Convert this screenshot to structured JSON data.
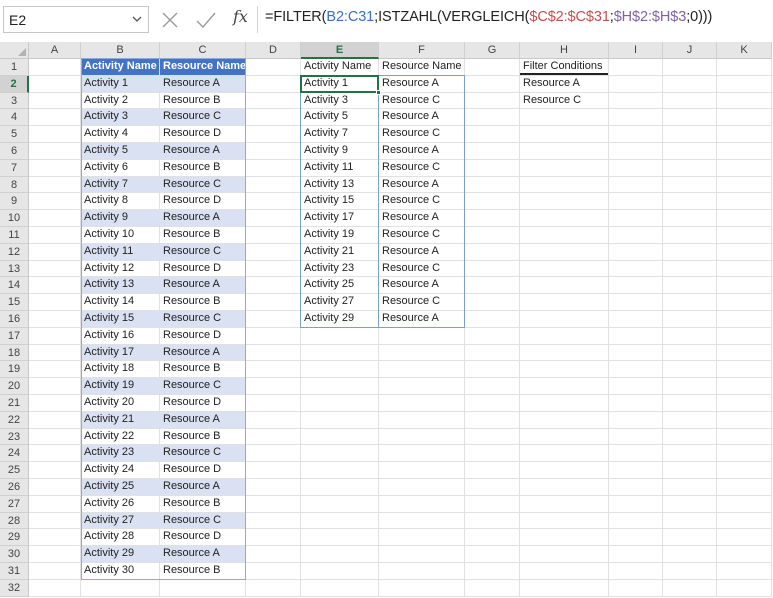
{
  "name_box": {
    "value": "E2"
  },
  "formula_bar": {
    "segments": [
      {
        "text": "=FILTER(",
        "color": "#222222"
      },
      {
        "text": "B2:C31",
        "color": "#3a6fc4"
      },
      {
        "text": ";ISTZAHL(VERGLEICH(",
        "color": "#222222"
      },
      {
        "text": "$C$2:$C$31",
        "color": "#c0504d"
      },
      {
        "text": ";",
        "color": "#222222"
      },
      {
        "text": "$H$2:$H$3",
        "color": "#8064a2"
      },
      {
        "text": ";0)))",
        "color": "#222222"
      }
    ]
  },
  "columns": [
    "A",
    "B",
    "C",
    "D",
    "E",
    "F",
    "G",
    "H",
    "I",
    "J",
    "K"
  ],
  "rows": [
    "1",
    "2",
    "3",
    "4",
    "5",
    "6",
    "7",
    "8",
    "9",
    "10",
    "11",
    "12",
    "13",
    "14",
    "15",
    "16",
    "17",
    "18",
    "19",
    "20",
    "21",
    "22",
    "23",
    "24",
    "25",
    "26",
    "27",
    "28",
    "29",
    "30",
    "31",
    "32"
  ],
  "selected": {
    "column": "E",
    "row": "2"
  },
  "source_table": {
    "headers": [
      "Activity Name",
      "Resource Name"
    ],
    "rows": [
      [
        "Activity 1",
        "Resource A"
      ],
      [
        "Activity 2",
        "Resource B"
      ],
      [
        "Activity 3",
        "Resource C"
      ],
      [
        "Activity 4",
        "Resource D"
      ],
      [
        "Activity 5",
        "Resource A"
      ],
      [
        "Activity 6",
        "Resource B"
      ],
      [
        "Activity 7",
        "Resource C"
      ],
      [
        "Activity 8",
        "Resource D"
      ],
      [
        "Activity 9",
        "Resource A"
      ],
      [
        "Activity 10",
        "Resource B"
      ],
      [
        "Activity 11",
        "Resource C"
      ],
      [
        "Activity 12",
        "Resource D"
      ],
      [
        "Activity 13",
        "Resource A"
      ],
      [
        "Activity 14",
        "Resource B"
      ],
      [
        "Activity 15",
        "Resource C"
      ],
      [
        "Activity 16",
        "Resource D"
      ],
      [
        "Activity 17",
        "Resource A"
      ],
      [
        "Activity 18",
        "Resource B"
      ],
      [
        "Activity 19",
        "Resource C"
      ],
      [
        "Activity 20",
        "Resource D"
      ],
      [
        "Activity 21",
        "Resource A"
      ],
      [
        "Activity 22",
        "Resource B"
      ],
      [
        "Activity 23",
        "Resource C"
      ],
      [
        "Activity 24",
        "Resource D"
      ],
      [
        "Activity 25",
        "Resource A"
      ],
      [
        "Activity 26",
        "Resource B"
      ],
      [
        "Activity 27",
        "Resource C"
      ],
      [
        "Activity 28",
        "Resource D"
      ],
      [
        "Activity 29",
        "Resource A"
      ],
      [
        "Activity 30",
        "Resource B"
      ]
    ]
  },
  "result_table": {
    "headers": [
      "Activity Name",
      "Resource Name"
    ],
    "rows": [
      [
        "Activity 1",
        "Resource A"
      ],
      [
        "Activity 3",
        "Resource C"
      ],
      [
        "Activity 5",
        "Resource A"
      ],
      [
        "Activity 7",
        "Resource C"
      ],
      [
        "Activity 9",
        "Resource A"
      ],
      [
        "Activity 11",
        "Resource C"
      ],
      [
        "Activity 13",
        "Resource A"
      ],
      [
        "Activity 15",
        "Resource C"
      ],
      [
        "Activity 17",
        "Resource A"
      ],
      [
        "Activity 19",
        "Resource C"
      ],
      [
        "Activity 21",
        "Resource A"
      ],
      [
        "Activity 23",
        "Resource C"
      ],
      [
        "Activity 25",
        "Resource A"
      ],
      [
        "Activity 27",
        "Resource C"
      ],
      [
        "Activity 29",
        "Resource A"
      ]
    ]
  },
  "filter_conditions": {
    "header": "Filter Conditions",
    "values": [
      "Resource A",
      "Resource C"
    ]
  },
  "colors": {
    "table_header": "#4472c4",
    "table_band": "#d9e1f2",
    "selection": "#217346"
  }
}
